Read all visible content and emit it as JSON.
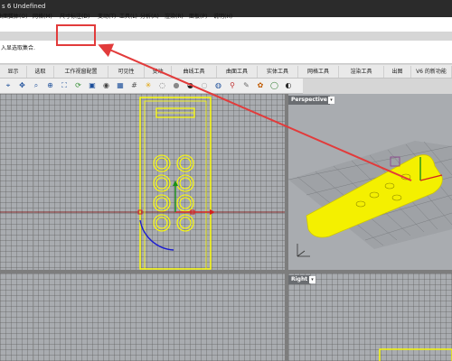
{
  "window": {
    "title": "s 6 Undefined"
  },
  "menu": {
    "items": [
      {
        "label": "文件(F)"
      },
      {
        "label": "编辑(E)"
      },
      {
        "label": "查看(V)"
      },
      {
        "label": "曲线(C)"
      },
      {
        "label": "曲面(S)"
      },
      {
        "label": "实体(O)"
      },
      {
        "label": "网格(M)"
      },
      {
        "label": "尺寸标注(D)"
      },
      {
        "label": "变动(T)"
      },
      {
        "label": "工具(L)"
      },
      {
        "label": "分析(A)"
      },
      {
        "label": "渲染(R)"
      },
      {
        "label": "面板(P)"
      },
      {
        "label": "说明(H)"
      }
    ]
  },
  "command": {
    "prompt": "入显选取集合."
  },
  "tabs": [
    {
      "label": "显示"
    },
    {
      "label": "选取"
    },
    {
      "label": "工作视窗配置"
    },
    {
      "label": "可见性"
    },
    {
      "label": "变动"
    },
    {
      "label": "曲线工具"
    },
    {
      "label": "曲面工具"
    },
    {
      "label": "实体工具"
    },
    {
      "label": "网格工具"
    },
    {
      "label": "渲染工具"
    },
    {
      "label": "出图"
    },
    {
      "label": "V6 的新功能"
    }
  ],
  "toolbar": {
    "icons": [
      "lasso-select-icon",
      "pan-icon",
      "zoom-window-icon",
      "zoom-icon",
      "zoom-extents-icon",
      "rotate-view-icon",
      "named-view-icon",
      "camera-icon",
      "viewport-layout-icon",
      "grid-icon",
      "light-icon",
      "wireframe-shade-icon",
      "shaded-ball-icon",
      "render-ball-icon",
      "ghost-ball-icon",
      "xray-ball-icon",
      "pin-icon",
      "tools-icon",
      "palette-icon",
      "globe-icon",
      "materials-icon"
    ]
  },
  "viewports": {
    "perspective": {
      "label": "Perspective"
    },
    "right": {
      "label": "Right"
    }
  },
  "colors": {
    "accent": "#ffff00",
    "annotation": "#e23b3b",
    "x_axis": "#d22020",
    "y_axis": "#1a8f1a",
    "z_axis": "#1c1cd0"
  }
}
